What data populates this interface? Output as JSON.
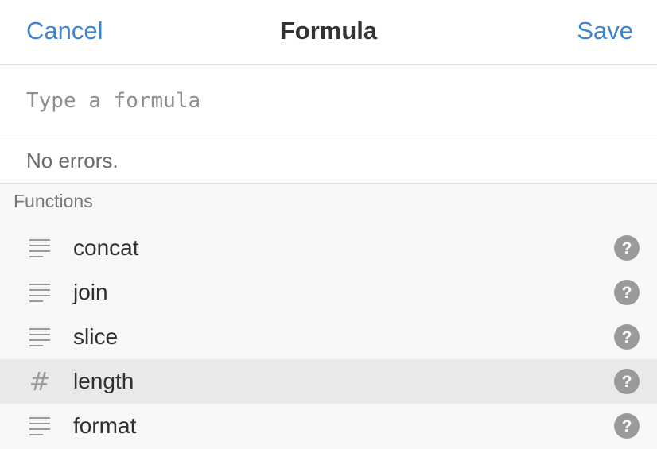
{
  "header": {
    "cancel_label": "Cancel",
    "title": "Formula",
    "save_label": "Save"
  },
  "formula": {
    "value": "",
    "placeholder": "Type a formula"
  },
  "status": {
    "text": "No errors."
  },
  "functions": {
    "section_title": "Functions",
    "items": [
      {
        "name": "concat",
        "icon": "text-lines-icon",
        "selected": false
      },
      {
        "name": "join",
        "icon": "text-lines-icon",
        "selected": false
      },
      {
        "name": "slice",
        "icon": "text-lines-icon",
        "selected": false
      },
      {
        "name": "length",
        "icon": "number-hash-icon",
        "selected": true
      },
      {
        "name": "format",
        "icon": "text-lines-icon",
        "selected": false
      }
    ]
  },
  "colors": {
    "accent": "#3c84cf",
    "selected_row": "#e9e9e9",
    "section_background": "#f7f7f7",
    "icon_gray": "#9a9a9a"
  }
}
